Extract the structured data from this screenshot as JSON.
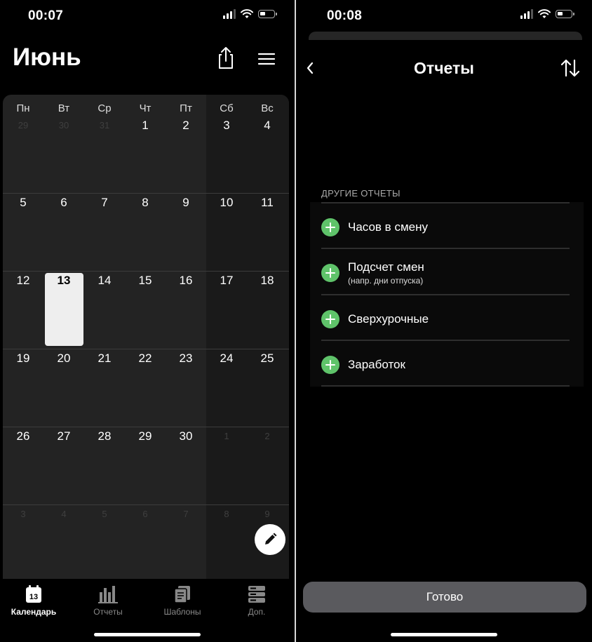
{
  "left": {
    "status": {
      "time": "00:07"
    },
    "header": {
      "month": "Июнь"
    },
    "calendar": {
      "weekdays": [
        "Пн",
        "Вт",
        "Ср",
        "Чт",
        "Пт",
        "Сб",
        "Вс"
      ],
      "weeks": [
        [
          {
            "d": "29",
            "dim": true
          },
          {
            "d": "30",
            "dim": true
          },
          {
            "d": "31",
            "dim": true
          },
          {
            "d": "1"
          },
          {
            "d": "2"
          },
          {
            "d": "3"
          },
          {
            "d": "4"
          }
        ],
        [
          {
            "d": "5"
          },
          {
            "d": "6"
          },
          {
            "d": "7"
          },
          {
            "d": "8"
          },
          {
            "d": "9"
          },
          {
            "d": "10"
          },
          {
            "d": "11"
          }
        ],
        [
          {
            "d": "12"
          },
          {
            "d": "13",
            "today": true
          },
          {
            "d": "14"
          },
          {
            "d": "15"
          },
          {
            "d": "16"
          },
          {
            "d": "17"
          },
          {
            "d": "18"
          }
        ],
        [
          {
            "d": "19"
          },
          {
            "d": "20"
          },
          {
            "d": "21"
          },
          {
            "d": "22"
          },
          {
            "d": "23"
          },
          {
            "d": "24"
          },
          {
            "d": "25"
          }
        ],
        [
          {
            "d": "26"
          },
          {
            "d": "27"
          },
          {
            "d": "28"
          },
          {
            "d": "29"
          },
          {
            "d": "30"
          },
          {
            "d": "1",
            "dim": true
          },
          {
            "d": "2",
            "dim": true
          }
        ],
        [
          {
            "d": "3",
            "dim": true
          },
          {
            "d": "4",
            "dim": true
          },
          {
            "d": "5",
            "dim": true
          },
          {
            "d": "6",
            "dim": true
          },
          {
            "d": "7",
            "dim": true
          },
          {
            "d": "8",
            "dim": true
          },
          {
            "d": "9",
            "dim": true
          }
        ]
      ]
    },
    "tabbar": {
      "items": [
        {
          "label": "Календарь",
          "icon": "calendar-icon",
          "badge": "13",
          "active": true
        },
        {
          "label": "Отчеты",
          "icon": "bar-chart-icon"
        },
        {
          "label": "Шаблоны",
          "icon": "documents-icon"
        },
        {
          "label": "Доп.",
          "icon": "server-icon"
        }
      ]
    }
  },
  "right": {
    "status": {
      "time": "00:08"
    },
    "nav": {
      "title": "Отчеты"
    },
    "section": {
      "header": "ДРУГИЕ ОТЧЕТЫ"
    },
    "items": [
      {
        "label": "Часов в смену"
      },
      {
        "label": "Подсчет смен",
        "sub": "(напр. дни отпуска)"
      },
      {
        "label": "Сверхурочные"
      },
      {
        "label": "Заработок"
      }
    ],
    "done_label": "Готово"
  },
  "colors": {
    "accent_green": "#5fc36a",
    "background": "#000000",
    "calendar_bg": "#232323",
    "button_gray": "#5a5a5e"
  }
}
